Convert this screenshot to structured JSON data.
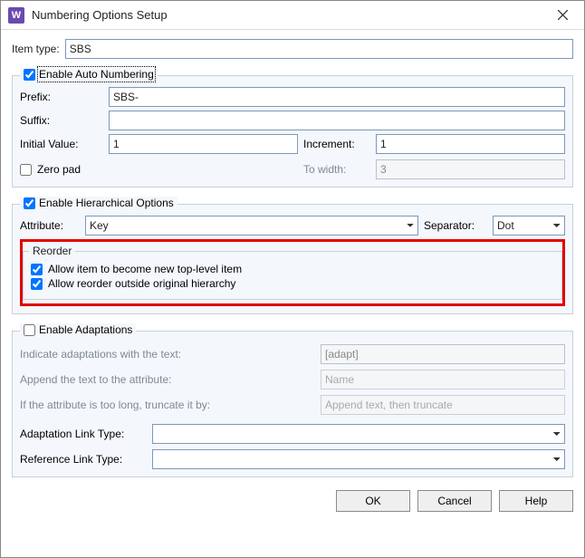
{
  "window": {
    "icon_letter": "W",
    "title": "Numbering Options Setup"
  },
  "item_type": {
    "label": "Item type:",
    "value": "SBS"
  },
  "auto_numbering": {
    "enable_label": "Enable Auto Numbering",
    "enabled": true,
    "prefix_label": "Prefix:",
    "prefix_value": "SBS-",
    "suffix_label": "Suffix:",
    "suffix_value": "",
    "initial_label": "Initial Value:",
    "initial_value": "1",
    "increment_label": "Increment:",
    "increment_value": "1",
    "zero_pad_label": "Zero pad",
    "zero_pad_checked": false,
    "to_width_label": "To width:",
    "to_width_value": "3"
  },
  "hierarchical": {
    "enable_label": "Enable Hierarchical Options",
    "enabled": true,
    "attribute_label": "Attribute:",
    "attribute_value": "Key",
    "separator_label": "Separator:",
    "separator_value": "Dot",
    "reorder_legend": "Reorder",
    "allow_top_label": "Allow item to become new top-level item",
    "allow_top_checked": true,
    "allow_outside_label": "Allow reorder outside original hierarchy",
    "allow_outside_checked": true
  },
  "adaptations": {
    "enable_label": "Enable Adaptations",
    "enabled": false,
    "indicate_label": "Indicate adaptations with the text:",
    "indicate_value": "[adapt]",
    "append_label": "Append the text to the attribute:",
    "append_value": "Name",
    "truncate_label": "If the attribute is too long, truncate it by:",
    "truncate_value": "Append text, then truncate",
    "adapt_link_label": "Adaptation Link Type:",
    "adapt_link_value": "",
    "ref_link_label": "Reference Link Type:",
    "ref_link_value": ""
  },
  "buttons": {
    "ok": "OK",
    "cancel": "Cancel",
    "help": "Help"
  }
}
